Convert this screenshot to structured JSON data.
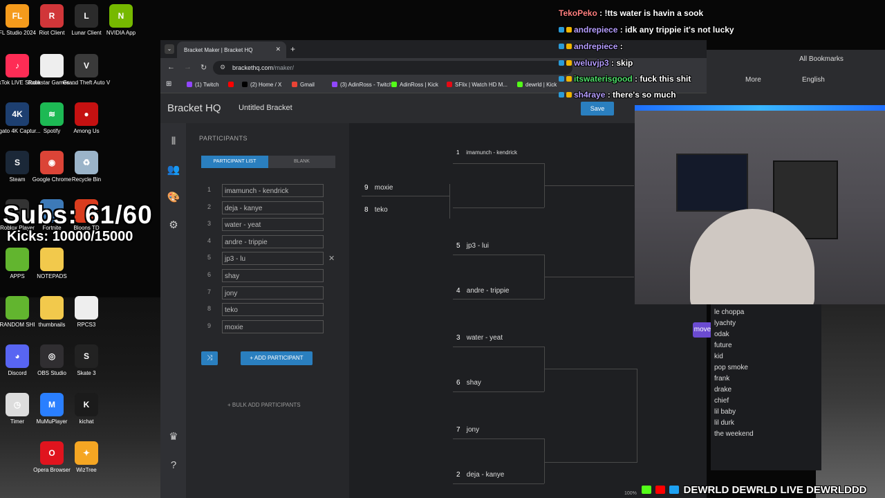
{
  "desktop": {
    "icons": [
      {
        "label": "FL Studio 2024",
        "color": "#f59b1c",
        "glyph": "FL"
      },
      {
        "label": "Riot Client",
        "color": "#d13639",
        "glyph": "R"
      },
      {
        "label": "Lunar Client",
        "color": "#2b2b2b",
        "glyph": "L"
      },
      {
        "label": "NVIDIA App",
        "color": "#76b900",
        "glyph": "N"
      },
      {
        "label": "TikTok LIVE Studio",
        "color": "#fe2c55",
        "glyph": "♪"
      },
      {
        "label": "Rockstar Games ...",
        "color": "#eeeeee",
        "glyph": ""
      },
      {
        "label": "Grand Theft Auto V",
        "color": "#3a3a3a",
        "glyph": "V"
      },
      {
        "label": "Elgato 4K Captur...",
        "color": "#1d3f70",
        "glyph": "4K"
      },
      {
        "label": "Spotify",
        "color": "#1db954",
        "glyph": "≋"
      },
      {
        "label": "Among Us",
        "color": "#c51111",
        "glyph": "●"
      },
      {
        "label": "Steam",
        "color": "#1b2838",
        "glyph": "S"
      },
      {
        "label": "Google Chrome",
        "color": "#db4437",
        "glyph": "◉"
      },
      {
        "label": "Recycle Bin",
        "color": "#9bb4c9",
        "glyph": "♻"
      },
      {
        "label": "Roblox Player",
        "color": "#333333",
        "glyph": ""
      },
      {
        "label": "Fortnite",
        "color": "#3d7ab8",
        "glyph": ""
      },
      {
        "label": "Bloons TD",
        "color": "#d93c1e",
        "glyph": ""
      },
      {
        "label": "APPS",
        "color": "#62b52f",
        "glyph": ""
      },
      {
        "label": "NOTEPADS",
        "color": "#f2c94c",
        "glyph": ""
      },
      {
        "label": "RANDOM SHI",
        "color": "#62b52f",
        "glyph": ""
      },
      {
        "label": "thumbnails",
        "color": "#f2c94c",
        "glyph": ""
      },
      {
        "label": "RPCS3",
        "color": "#eeeeee",
        "glyph": ""
      },
      {
        "label": "Discord",
        "color": "#5865f2",
        "glyph": "◕"
      },
      {
        "label": "OBS Studio",
        "color": "#302e31",
        "glyph": "◎"
      },
      {
        "label": "Skate 3",
        "color": "#222222",
        "glyph": "S"
      },
      {
        "label": "Timer",
        "color": "#dddddd",
        "glyph": "◷"
      },
      {
        "label": "MuMuPlayer",
        "color": "#2a7fff",
        "glyph": "M"
      },
      {
        "label": "kichat",
        "color": "#1b1b1b",
        "glyph": "K"
      },
      {
        "label": "Opera Browser",
        "color": "#e0141e",
        "glyph": "O"
      },
      {
        "label": "WizTree",
        "color": "#f5a623",
        "glyph": "✦"
      }
    ],
    "subs": "Subs: 61/60",
    "kicks": "Kicks: 10000/15000"
  },
  "browser": {
    "tab_title": "Bracket Maker | Bracket HQ",
    "url_host": "brackethq.com",
    "url_path": "/maker/",
    "bookmarks": [
      {
        "label": "(1) Twitch",
        "color": "#9146ff"
      },
      {
        "label": "",
        "color": "#ff0000"
      },
      {
        "label": "(2) Home / X",
        "color": "#000000"
      },
      {
        "label": "Gmail",
        "color": "#ea4335"
      },
      {
        "label": "(3) AdinRoss - Twitch",
        "color": "#9146ff"
      },
      {
        "label": "AdinRoss | Kick",
        "color": "#53fc18"
      },
      {
        "label": "SFlix | Watch HD M...",
        "color": "#e50914"
      },
      {
        "label": "dewrld | Kick",
        "color": "#53fc18"
      }
    ]
  },
  "app": {
    "logo_a": "Bracket",
    "logo_b": "HQ",
    "bracket_title": "Untitled Bracket",
    "save_label": "Save",
    "participants_title": "PARTICIPANTS",
    "tab_list": "PARTICIPANT LIST",
    "tab_blank": "BLANK",
    "participants": [
      {
        "seed": "1",
        "name": "imamunch - kendrick"
      },
      {
        "seed": "2",
        "name": "deja - kanye"
      },
      {
        "seed": "3",
        "name": "water - yeat"
      },
      {
        "seed": "4",
        "name": "andre - trippie"
      },
      {
        "seed": "5",
        "name": "jp3 - lu"
      },
      {
        "seed": "6",
        "name": "shay"
      },
      {
        "seed": "7",
        "name": "jony"
      },
      {
        "seed": "8",
        "name": "teko"
      },
      {
        "seed": "9",
        "name": "moxie"
      }
    ],
    "add_participant": "+ ADD PARTICIPANT",
    "bulk_add": "+ BULK ADD PARTICIPANTS",
    "bracket": [
      {
        "seed": "9",
        "name": "moxie"
      },
      {
        "seed": "8",
        "name": "teko"
      },
      {
        "seed": "1",
        "name": "imamunch - kendrick"
      },
      {
        "seed": "5",
        "name": "jp3 - lui"
      },
      {
        "seed": "4",
        "name": "andre - trippie"
      },
      {
        "seed": "3",
        "name": "water - yeat"
      },
      {
        "seed": "6",
        "name": "shay"
      },
      {
        "seed": "7",
        "name": "jony"
      },
      {
        "seed": "2",
        "name": "deja - kanye"
      }
    ]
  },
  "chat": [
    {
      "user": "TekoPeko",
      "msg": ": !tts water is havin a sook",
      "color": "#ff7f7f"
    },
    {
      "user": "andrepiece",
      "msg": ": idk any trippie it's not lucky",
      "color": "#b59dff"
    },
    {
      "user": "andrepiece",
      "msg": ":",
      "color": "#b59dff"
    },
    {
      "user": "weluvjp3",
      "msg": ": skip",
      "color": "#b59dff"
    },
    {
      "user": "itswaterisgood",
      "msg": ": fuck this shit",
      "color": "#4fe06a"
    },
    {
      "user": "sh4raye",
      "msg": ": there's so much",
      "color": "#b59dff"
    }
  ],
  "right_browser": {
    "all_bookmarks": "All Bookmarks",
    "more": "More",
    "language": "English"
  },
  "right_list": {
    "move_label": "move",
    "items": [
      "le choppa",
      "lyachty",
      "odak",
      "future",
      "kid",
      "pop smoke",
      "frank",
      "drake",
      "chief",
      "lil baby",
      "lil durk",
      "the weekend"
    ]
  },
  "socials": "DEWRLD DEWRLD LIVE DEWRLDDD",
  "zoom": "100%"
}
